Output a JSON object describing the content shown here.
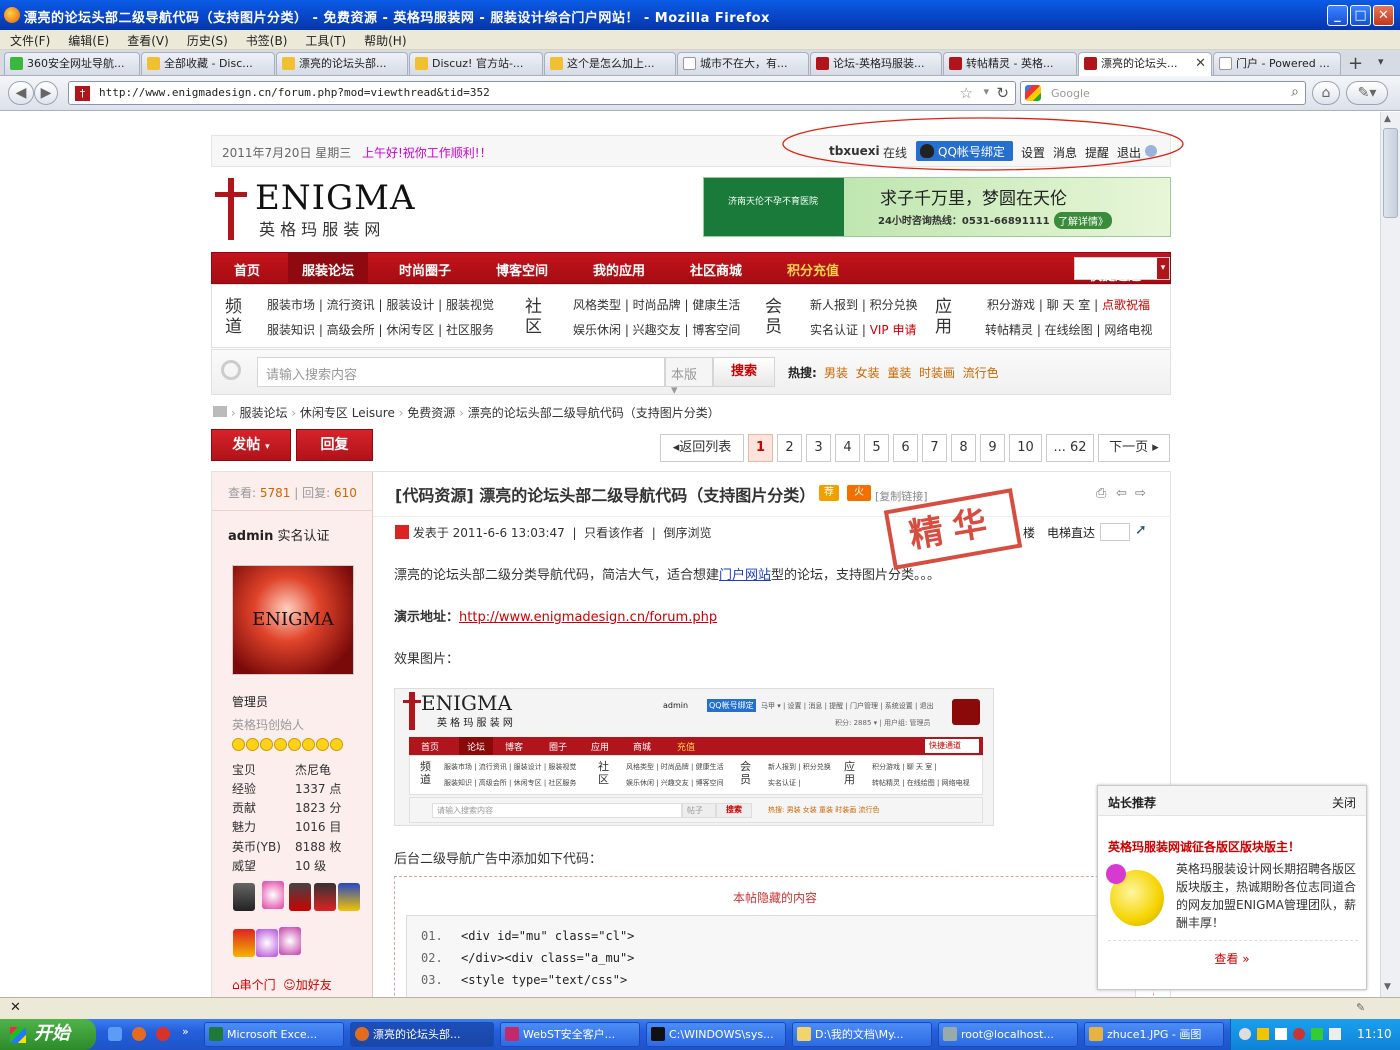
{
  "window": {
    "title": "漂亮的论坛头部二级导航代码（支持图片分类） - 免费资源 - 英格玛服装网 - 服装设计综合门户网站！ - Mozilla Firefox"
  },
  "menu": [
    "文件(F)",
    "编辑(E)",
    "查看(V)",
    "历史(S)",
    "书签(B)",
    "工具(T)",
    "帮助(H)"
  ],
  "tabs": [
    "360安全网址导航...",
    "全部收藏 - Disc...",
    "漂亮的论坛头部...",
    "Discuz! 官方站-...",
    "这个是怎么加上...",
    "城市不在大，有...",
    "论坛-英格玛服装...",
    "转帖精灵 - 英格...",
    "漂亮的论坛头...",
    "门户 - Powered ..."
  ],
  "url": "http://www.enigmadesign.cn/forum.php?mod=viewthread&tid=352",
  "search_placeholder": "Google",
  "topinfo": {
    "date": "2011年7月20日 星期三",
    "greet": "上午好!祝你工作顺利!！",
    "user": "tbxuexi",
    "online": "在线",
    "qq": "QQ帐号绑定",
    "links": [
      "设置",
      "消息",
      "提醒",
      "退出"
    ]
  },
  "logo": {
    "main": "ENIGMA",
    "sub": "英 格 玛 服 装 网"
  },
  "ad": {
    "hospital": "济南天伦不孕不育医院",
    "slogan": "求子千万里，梦圆在天伦",
    "hotline": "24小时咨询热线：0531-66891111",
    "more": "了解详情》"
  },
  "nav": [
    "首页",
    "服装论坛",
    "时尚圈子",
    "博客空间",
    "我的应用",
    "社区商城",
    "积分充值"
  ],
  "quick": "快捷通道",
  "subnav": {
    "c1": "频道",
    "c1r1": "服装市场 | 流行资讯 | 服装设计 | 服装视觉",
    "c1r2": "服装知识 | 高级会所 | 休闲专区 | 社区服务",
    "c2": "社区",
    "c2r1": "风格类型 | 时尚品牌 | 健康生活",
    "c2r2": "娱乐休闲 | 兴趣交友 | 博客空间",
    "c3": "会员",
    "c3r1": "新人报到 | 积分兑换",
    "c3r2a": "实名认证 |",
    "c3r2b": "VIP 申请",
    "c4": "应用",
    "c4r1a": "积分游戏 | 聊 天 室 |",
    "c4r1b": "点歌祝福",
    "c4r2": "转帖精灵 | 在线绘图 | 网络电视"
  },
  "search": {
    "placeholder": "请输入搜索内容",
    "scope": "本版",
    "button": "搜索",
    "hot_label": "热搜:",
    "hot": [
      "男装",
      "女装",
      "童装",
      "时装画",
      "流行色"
    ]
  },
  "breadcrumb": [
    "服装论坛",
    "休闲专区 Leisure",
    "免费资源",
    "漂亮的论坛头部二级导航代码（支持图片分类）"
  ],
  "actions": {
    "post": "发帖",
    "reply": "回复"
  },
  "pager": {
    "back": "返回列表",
    "pages": [
      "1",
      "2",
      "3",
      "4",
      "5",
      "6",
      "7",
      "8",
      "9",
      "10",
      "... 62"
    ],
    "next": "下一页"
  },
  "post": {
    "views_label": "查看:",
    "views": "5781",
    "replies_label": "回复:",
    "replies": "610",
    "author": "admin",
    "verified": "实名认证",
    "avatar_text": "ENIGMA",
    "role": "管理员",
    "role2": "英格玛创始人",
    "stats": [
      [
        "宝贝",
        "杰尼龟"
      ],
      [
        "经验",
        "1337 点"
      ],
      [
        "贡献",
        "1823 分"
      ],
      [
        "魅力",
        "1016 目"
      ],
      [
        "英币(YB)",
        "8188 枚"
      ],
      [
        "威望",
        "10 级"
      ]
    ],
    "foot_links": [
      "串个门",
      "加好友"
    ],
    "title": "[代码资源] 漂亮的论坛头部二级导航代码（支持图片分类）",
    "tag1": "荐",
    "tag2": "火",
    "copy": "[复制链接]",
    "posted": "发表于 2011-6-6 13:03:47",
    "only_author": "只看该作者",
    "reverse": "倒序浏览",
    "floor": "楼",
    "elevator": "电梯直达",
    "stamp": "精华",
    "p1a": "漂亮的论坛头部二级分类导航代码，简洁大气，适合想建",
    "p1link": "门户网站",
    "p1b": "型的论坛，支持图片分类。。。",
    "demo_label": "演示地址：",
    "demo_url": "http://www.enigmadesign.cn/forum.php",
    "effect": "效果图片：",
    "p2": "后台二级导航广告中添加如下代码：",
    "hidden": "本帖隐藏的内容",
    "code": [
      [
        "01.",
        "<div id=\"mu\" class=\"cl\">"
      ],
      [
        "02.",
        "</div><div class=\"a_mu\">"
      ],
      [
        "03.",
        "<style type=\"text/css\">"
      ]
    ]
  },
  "shot": {
    "logo": "ENIGMA",
    "sub": "英 格 玛 服 装 网",
    "user": "admin",
    "qq": "QQ帐号绑定",
    "links": "马甲 ▾ | 设置 | 消息 | 提醒 | 门户管理 | 系统设置 | 退出",
    "credits": "积分: 2885 ▾  |  用户组: 管理员",
    "nav": [
      "首页",
      "论坛",
      "博客",
      "圈子",
      "应用",
      "商城",
      "充值"
    ],
    "quick": "快捷通道",
    "search": "请输入搜索内容",
    "scope": "帖子",
    "btn": "搜索",
    "hot": "热搜: 男装 女装 童装 时装画 流行色"
  },
  "popup": {
    "title": "站长推荐",
    "close": "关闭",
    "headline": "英格玛服装网诚征各版区版块版主！",
    "body": "英格玛服装设计网长期招聘各版区版块版主，热诚期盼各位志同道合的网友加盟ENIGMA管理团队，薪酬丰厚！",
    "more": "查看 »"
  },
  "taskbar": {
    "start": "开始",
    "tasks": [
      "Microsoft Exce...",
      "漂亮的论坛头部...",
      "WebST安全客户...",
      "C:\\WINDOWS\\sys...",
      "D:\\我的文档\\My...",
      "root@localhost...",
      "zhuce1.JPG - 画图"
    ],
    "time": "11:10"
  },
  "colors": {
    "brand_red": "#b1121a",
    "title_blue": "#0844c4",
    "link_orange": "#c60"
  }
}
